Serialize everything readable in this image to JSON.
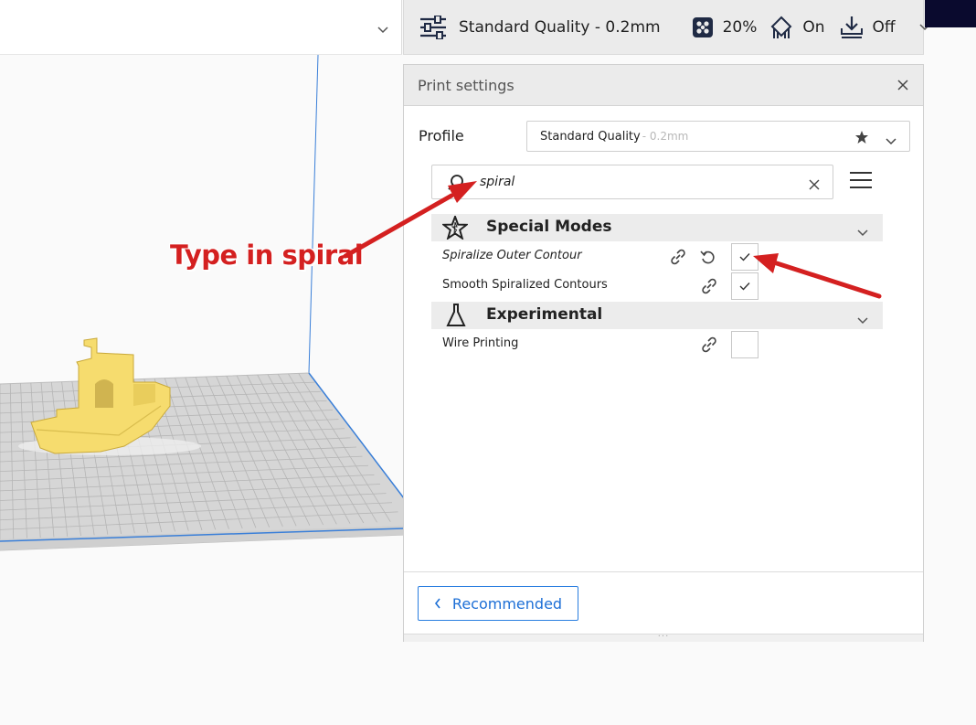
{
  "topbar": {
    "quality_profile": "Standard Quality - 0.2mm",
    "infill_value": "20%",
    "support_value": "On",
    "adhesion_value": "Off"
  },
  "print_settings": {
    "title": "Print settings",
    "profile_label": "Profile",
    "profile_name": "Standard Quality",
    "profile_suffix": " - 0.2mm",
    "search_value": "spiral",
    "categories": [
      {
        "label": "Special Modes",
        "icon": "star-outline-icon",
        "settings": [
          {
            "label": "Spiralize Outer Contour",
            "checked": true,
            "italic": true
          },
          {
            "label": "Smooth Spiralized Contours",
            "checked": true,
            "italic": false
          }
        ]
      },
      {
        "label": "Experimental",
        "icon": "flask-icon",
        "settings": [
          {
            "label": "Wire Printing",
            "checked": false,
            "italic": false
          }
        ]
      }
    ],
    "recommended_label": "Recommended"
  },
  "annotation": {
    "text": "Type in spiral",
    "color": "#d42020"
  },
  "colors": {
    "accent": "#2a7ee0",
    "model": "#f6dc6e",
    "plate": "#d8d8d8",
    "plate_edge": "#3a7fd8"
  }
}
